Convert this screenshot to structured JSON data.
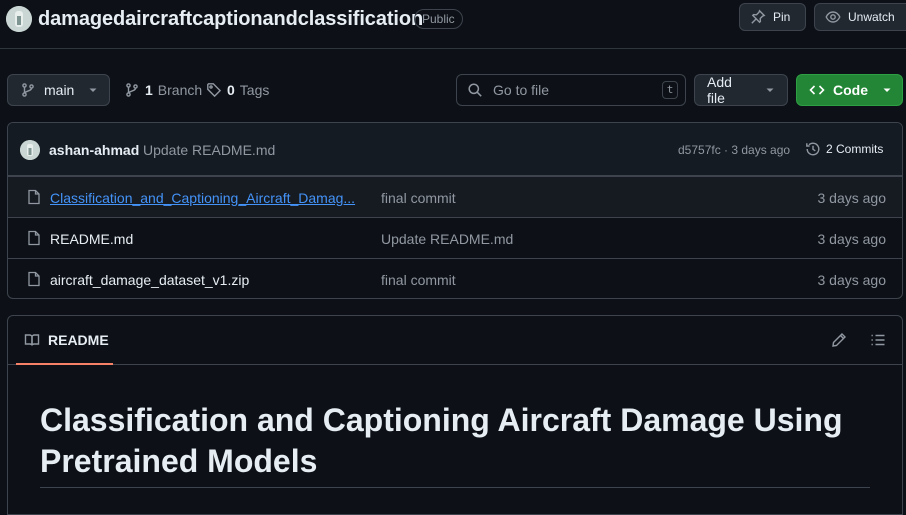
{
  "repo": {
    "name": "damagedaircraftcaptionandclassification",
    "visibility": "Public",
    "pin_label": "Pin",
    "watch_label": "Unwatch"
  },
  "toolbar": {
    "branch": "main",
    "branch_count": "1",
    "branch_word": "Branch",
    "tag_count": "0",
    "tag_word": "Tags",
    "search_placeholder": "Go to file",
    "search_shortcut": "t",
    "add_file_label": "Add file",
    "code_label": "Code"
  },
  "latest_commit": {
    "author": "ashan-ahmad",
    "message": "Update README.md",
    "hash_age": "d5757fc · 3 days ago",
    "commits_label": "2 Commits"
  },
  "files": [
    {
      "name": "Classification_and_Captioning_Aircraft_Damag...",
      "message": "final commit",
      "date": "3 days ago",
      "icon": "file-icon"
    },
    {
      "name": "README.md",
      "message": "Update README.md",
      "date": "3 days ago",
      "icon": "file-icon"
    },
    {
      "name": "aircraft_damage_dataset_v1.zip",
      "message": "final commit",
      "date": "3 days ago",
      "icon": "file-icon"
    }
  ],
  "readme": {
    "tab_label": "README",
    "heading": "Classification and Captioning Aircraft Damage Using Pretrained Models"
  },
  "colors": {
    "background": "#0d1117",
    "accent_green": "#238636",
    "link_blue": "#4493f8",
    "tab_underline": "#f78166"
  }
}
